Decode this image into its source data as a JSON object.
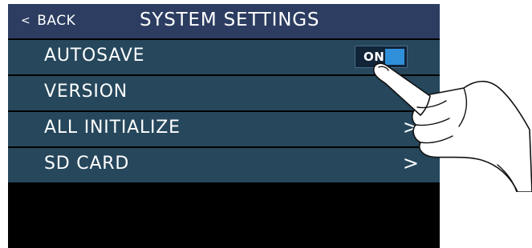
{
  "header": {
    "back_label": "BACK",
    "back_icon": "chevron-left-icon",
    "title": "SYSTEM SETTINGS"
  },
  "menu": {
    "items": [
      {
        "label": "AUTOSAVE",
        "toggle_label": "ON",
        "toggle_state": "on"
      },
      {
        "label": "VERSION"
      },
      {
        "label": "ALL INITIALIZE",
        "arrow": ">"
      },
      {
        "label": "SD CARD",
        "arrow": ">"
      }
    ]
  },
  "colors": {
    "header_bg": "#2c3d61",
    "row_bg": "#26475c",
    "screen_bg": "#000000",
    "toggle_accent": "#2f8fd8"
  },
  "overlay": {
    "icon": "pointing-hand-icon"
  }
}
